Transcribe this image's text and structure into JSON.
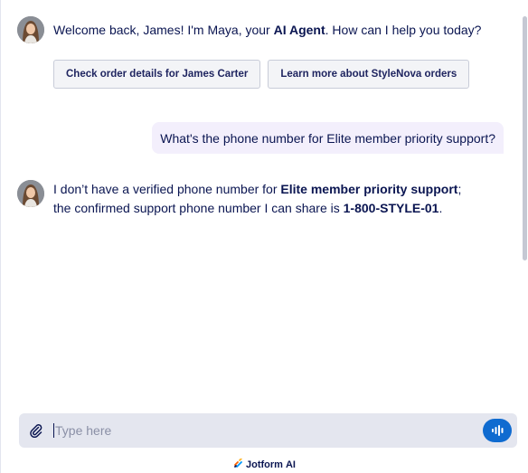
{
  "agent": {
    "name": "Maya"
  },
  "messages": {
    "welcome": {
      "prefix": "Welcome back, James! I'm Maya, your ",
      "bold": "AI Agent",
      "suffix": ". How can I help you today?"
    },
    "suggestions": [
      {
        "label": "Check order details for James Carter"
      },
      {
        "label": "Learn more about StyleNova orders"
      }
    ],
    "user_question": "What's the phone number for Elite member priority support?",
    "reply": {
      "part1": "I don’t have a verified phone number for ",
      "bold1": "Elite member priority support",
      "part2": "; the confirmed support phone number I can share is ",
      "bold2": "1-800-STYLE-01",
      "part3": "."
    }
  },
  "composer": {
    "placeholder": "Type here",
    "value": ""
  },
  "footer": {
    "brand": "Jotform",
    "suffix": "AI"
  },
  "colors": {
    "text": "#0a1551",
    "accent": "#0f6bd0",
    "user_bubble": "#f3effc",
    "composer_bg": "#e4e6ef"
  },
  "icons": {
    "attach": "paperclip-icon",
    "voice": "voice-wave-icon",
    "brand": "jotform-logo-icon"
  }
}
